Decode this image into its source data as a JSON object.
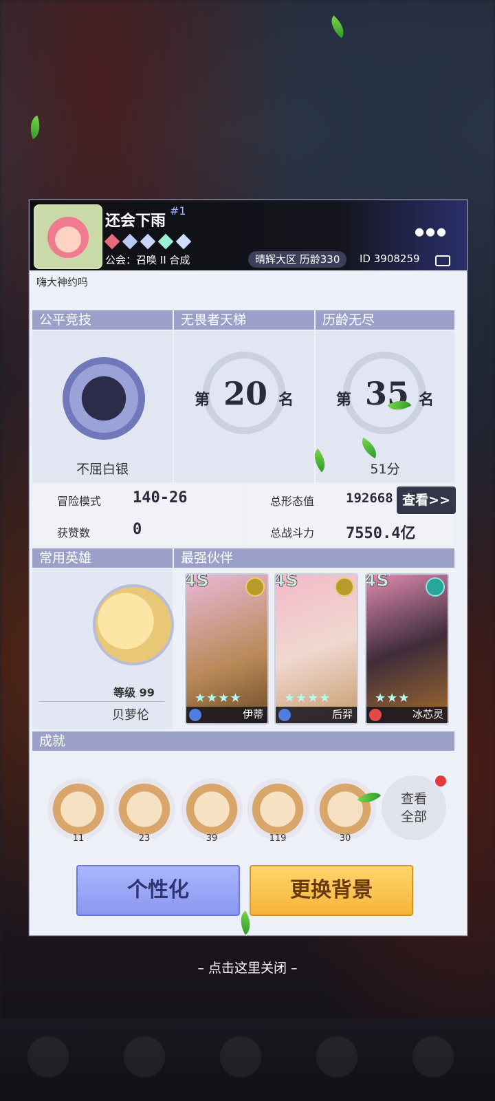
{
  "profile": {
    "nickname": "还会下雨",
    "rank_tag": "#1",
    "guild": "公会：召唤 II 合成",
    "server": "晴辉大区  历龄330",
    "uid": "ID 3908259",
    "more_icon": "⦁⦁⦁",
    "signature": "嗨大神约吗"
  },
  "sections": {
    "fair": "公平竞技",
    "ladder": "无畏者天梯",
    "endless": "历龄无尽",
    "common_hero": "常用英雄",
    "strongest": "最强伙伴",
    "achievements": "成就"
  },
  "fair": {
    "tier": "不屈白银"
  },
  "ladder": {
    "prefix": "第",
    "rank": "20",
    "suffix": "名"
  },
  "endless": {
    "prefix": "第",
    "rank": "35",
    "suffix": "名",
    "score": "51分"
  },
  "stats": {
    "adventure_label": "冒险模式",
    "adventure_val": "140-26",
    "likes_label": "获赞数",
    "likes_val": "0",
    "form_label": "总形态值",
    "form_val": "192668",
    "power_label": "总战斗力",
    "power_val": "7550.4亿",
    "view_btn": "查看>>"
  },
  "hero": {
    "level": "等级 99",
    "name": "贝萝伦"
  },
  "partners": [
    {
      "grade": "4S",
      "name": "伊蒂",
      "stars": "★★★★"
    },
    {
      "grade": "4S",
      "name": "后羿",
      "stars": "★★★★"
    },
    {
      "grade": "4S",
      "name": "冰芯灵",
      "stars": "★★★"
    }
  ],
  "achievements": [
    "11",
    "23",
    "39",
    "119",
    "30"
  ],
  "ach_more": {
    "line1": "查看",
    "line2": "全部"
  },
  "buttons": {
    "personalize": "个性化",
    "change_bg": "更换背景"
  },
  "close_hint": "– 点击这里关闭 –",
  "colors": {
    "header_bg": "#14141c",
    "section": "#9aa0c8",
    "btn_blue": "#9aa6f6",
    "btn_yellow": "#f8c54e"
  }
}
